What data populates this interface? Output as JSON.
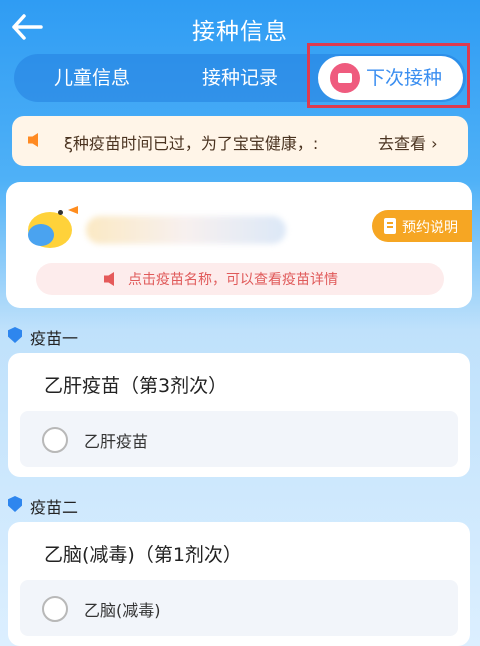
{
  "header": {
    "title": "接种信息"
  },
  "tabs": [
    {
      "label": "儿童信息"
    },
    {
      "label": "接种记录"
    },
    {
      "label": "下次接种"
    }
  ],
  "notice": {
    "text": "ξ种疫苗时间已过，为了宝宝健康，:",
    "link": "去查看"
  },
  "baby_card": {
    "appointment_label": "预约说明",
    "tip": "点击疫苗名称，可以查看疫苗详情"
  },
  "vaccines": [
    {
      "section": "疫苗一",
      "title": "乙肝疫苗（第3剂次）",
      "option": "乙肝疫苗"
    },
    {
      "section": "疫苗二",
      "title": "乙脑(减毒)（第1剂次）",
      "option": "乙脑(减毒)"
    }
  ],
  "colors": {
    "primary": "#2f9cf3",
    "highlight": "#de3b4f",
    "accent_orange": "#f6a623"
  }
}
